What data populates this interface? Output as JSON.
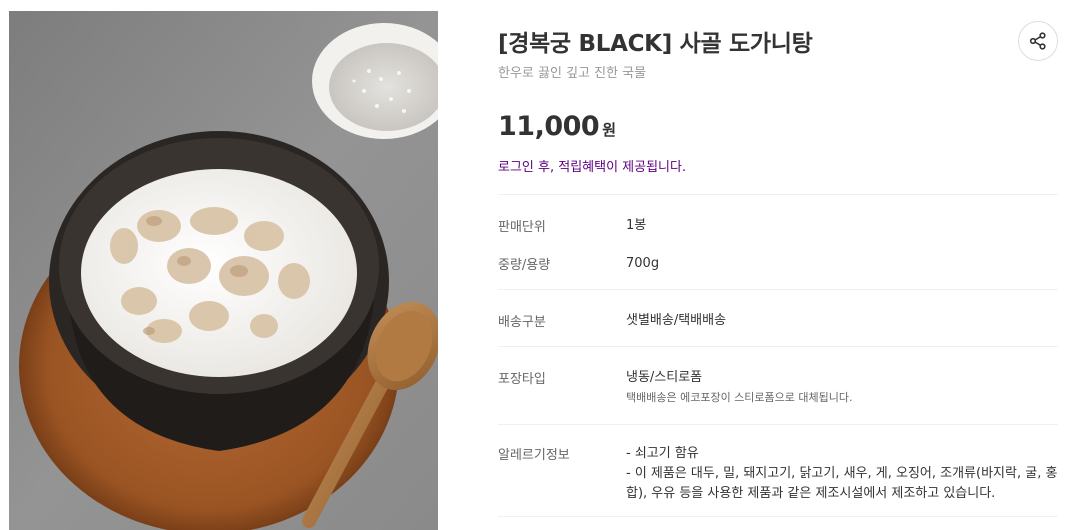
{
  "product": {
    "title": "[경복궁 BLACK] 사골 도가니탕",
    "subtitle": "한우로 끓인 깊고 진한 국물",
    "price": "11,000",
    "currency": "원",
    "login_notice": "로그인 후, 적립혜택이 제공됩니다.",
    "share_icon": "share-icon",
    "image_alt": "사골 도가니탕"
  },
  "details": {
    "unit": {
      "label": "판매단위",
      "value": "1봉"
    },
    "weight": {
      "label": "중량/용량",
      "value": "700g"
    },
    "delivery": {
      "label": "배송구분",
      "value": "샛별배송/택배배송"
    },
    "packaging": {
      "label": "포장타입",
      "value": "냉동/스티로폼",
      "note": "택배배송은 에코포장이 스티로폼으로 대체됩니다."
    },
    "allergy": {
      "label": "알레르기정보",
      "lines": [
        "- 쇠고기 함유",
        "- 이 제품은 대두, 밀, 돼지고기, 닭고기, 새우, 게, 오징어, 조개류(바지락, 굴, 홍",
        "합), 우유 등을 사용한 제품과 같은 제조시설에서 제조하고 있습니다."
      ]
    }
  },
  "colors": {
    "accent": "#5f0080",
    "muted": "#999999",
    "divider": "#f0f0f0"
  }
}
